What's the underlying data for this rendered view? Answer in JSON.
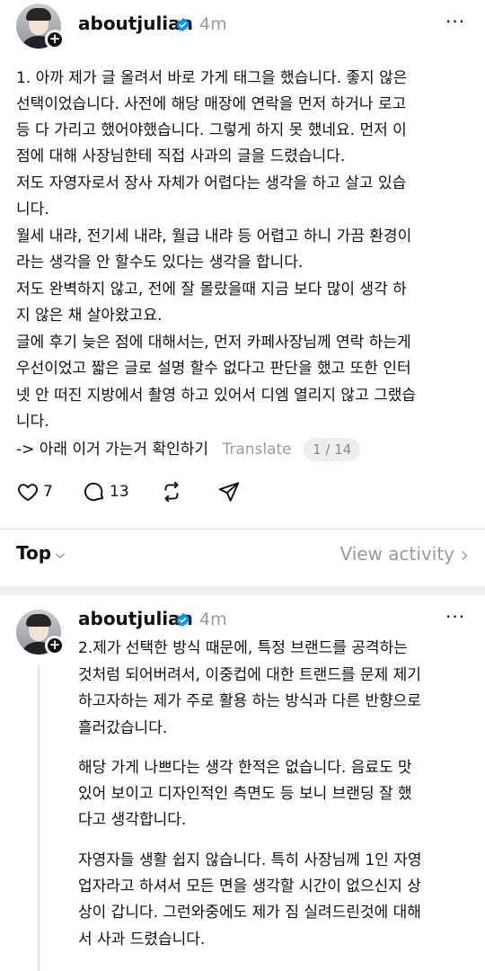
{
  "post1": {
    "username": "aboutjulian",
    "time": "4m",
    "more": "···",
    "lines": [
      "1. 아까 제가 글 올려서 바로 가게 태그을 했습니다. 좋지 않은",
      "선택이었습니다. 사전에 해당 매장에 연락을 먼저 하거나 로고",
      "등 다 가리고 했어야했습니다. 그렇게 하지 못 했네요. 먼저 이",
      "점에 대해 사장님한테 직접 사과의 글을 드렸습니다.",
      " 저도 자영자로서 장사 자체가 어렵다는 생각을 하고 살고 있습",
      "니다.",
      "월세 내랴, 전기세 내랴, 월급 내랴 등 어렵고 하니 가끔 환경이",
      "라는 생각을 안 할수도 있다는 생각을 합니다.",
      "저도 완벽하지 않고, 전에 잘 몰랐을때 지금 보다 많이 생각 하",
      "지 않은 채 살아왔고요.",
      "글에 후기 늦은 점에 대해서는, 먼저 카페사장님께 연락 하는게",
      "우선이었고 짧은 글로 설명 할수 없다고 판단을 했고 또한 인터",
      "넷 안 떠진 지방에서 촬영 하고 있어서 디엠 열리지 않고 그랬습",
      "니다."
    ],
    "last_line": "-> 아래 이거 가는거 확인하기",
    "translate": "Translate",
    "pager": "1 / 14",
    "likes": "7",
    "comments": "13"
  },
  "sort": {
    "label": "Top",
    "view_activity": "View activity"
  },
  "post2": {
    "username": "aboutjulian",
    "time": "4m",
    "more": "···",
    "lines": [
      "2.제가 선택한 방식 때문에, 특정 브랜드를 공격하는",
      "것처럼 되어버려서, 이중컵에 대한 트랜드를 문제 제기",
      "하고자하는 제가 주로 활용 하는 방식과 다른 반향으로",
      "흘러갔습니다.",
      "해당 가게 나쁘다는 생각 한적은 없습니다. 음료도 맛",
      "있어 보이고 디자인적인 측면도 등 보니 브랜딩 잘 했",
      "다고 생각합니다.",
      "자영자들 생활 쉽지 않습니다. 특히 사장님께 1인 자영",
      "업자라고 하셔서 모든 면을 생각할 시간이 없으신지 상",
      "상이 갑니다. 그런와중에도 제가 짐 실려드린것에 대해",
      "서 사과 드렸습니다."
    ]
  },
  "colors": {
    "verified": "#0095f6",
    "muted": "#9a9a9a",
    "text": "#101010"
  }
}
